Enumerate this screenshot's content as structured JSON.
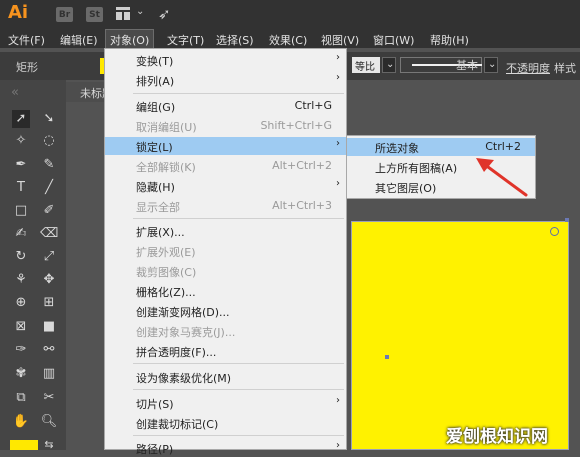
{
  "app": {
    "logo": "Ai",
    "br": "Br",
    "st": "St"
  },
  "menubar": [
    "文件(F)",
    "编辑(E)",
    "对象(O)",
    "文字(T)",
    "选择(S)",
    "效果(C)",
    "视图(V)",
    "窗口(W)",
    "帮助(H)"
  ],
  "controlbar": {
    "shape_label": "矩形",
    "blend": "等比",
    "stroke_style": "基本",
    "opacity_label": "不透明度",
    "style_label": "样式"
  },
  "document_tab": "未标题",
  "object_menu": [
    {
      "label": "变换(T)",
      "shortcut": "",
      "submenu": true,
      "disabled": false
    },
    {
      "label": "排列(A)",
      "shortcut": "",
      "submenu": true,
      "disabled": false
    },
    {
      "label": "编组(G)",
      "shortcut": "Ctrl+G",
      "submenu": false,
      "disabled": false
    },
    {
      "label": "取消编组(U)",
      "shortcut": "Shift+Ctrl+G",
      "submenu": false,
      "disabled": true
    },
    {
      "label": "锁定(L)",
      "shortcut": "",
      "submenu": true,
      "disabled": false,
      "highlighted": true
    },
    {
      "label": "全部解锁(K)",
      "shortcut": "Alt+Ctrl+2",
      "submenu": false,
      "disabled": true
    },
    {
      "label": "隐藏(H)",
      "shortcut": "",
      "submenu": true,
      "disabled": false
    },
    {
      "label": "显示全部",
      "shortcut": "Alt+Ctrl+3",
      "submenu": false,
      "disabled": true
    },
    {
      "label": "扩展(X)...",
      "shortcut": "",
      "submenu": false,
      "disabled": false
    },
    {
      "label": "扩展外观(E)",
      "shortcut": "",
      "submenu": false,
      "disabled": true
    },
    {
      "label": "裁剪图像(C)",
      "shortcut": "",
      "submenu": false,
      "disabled": true
    },
    {
      "label": "栅格化(Z)...",
      "shortcut": "",
      "submenu": false,
      "disabled": false
    },
    {
      "label": "创建渐变网格(D)...",
      "shortcut": "",
      "submenu": false,
      "disabled": false
    },
    {
      "label": "创建对象马赛克(J)...",
      "shortcut": "",
      "submenu": false,
      "disabled": true
    },
    {
      "label": "拼合透明度(F)...",
      "shortcut": "",
      "submenu": false,
      "disabled": false
    },
    {
      "label": "设为像素级优化(M)",
      "shortcut": "",
      "submenu": false,
      "disabled": false
    },
    {
      "label": "切片(S)",
      "shortcut": "",
      "submenu": true,
      "disabled": false
    },
    {
      "label": "创建裁切标记(C)",
      "shortcut": "",
      "submenu": false,
      "disabled": false
    },
    {
      "label": "路径(P)",
      "shortcut": "",
      "submenu": true,
      "disabled": false
    }
  ],
  "lock_submenu": [
    {
      "label": "所选对象",
      "shortcut": "Ctrl+2",
      "highlighted": true
    },
    {
      "label": "上方所有图稿(A)",
      "shortcut": ""
    },
    {
      "label": "其它图层(O)",
      "shortcut": ""
    }
  ],
  "watermark": "爱刨根知识网",
  "colors": {
    "accent_highlight": "#9ecbf2",
    "fill": "#fff200",
    "arrow": "#e0342a"
  }
}
